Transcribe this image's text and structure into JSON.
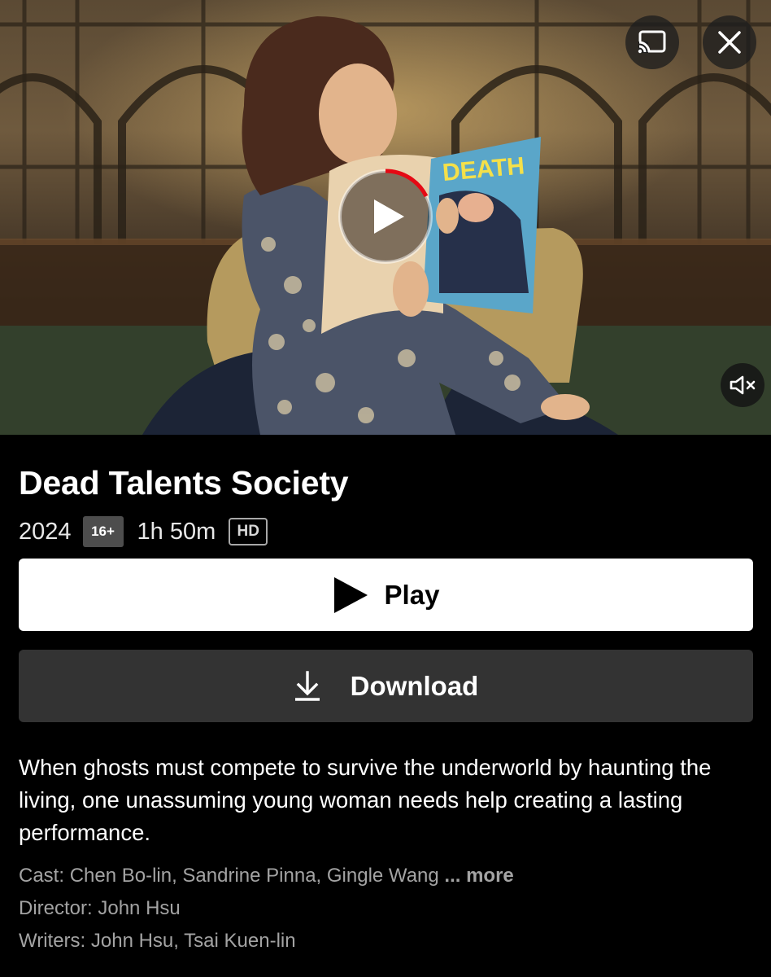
{
  "hero": {
    "cast_icon": "cast-icon",
    "close_icon": "close-icon",
    "play_icon": "play-icon",
    "mute_icon": "volume-muted-icon",
    "magazine_text": "DEATH",
    "progress_color": "#e50914"
  },
  "title": "Dead Talents Society",
  "meta": {
    "year": "2024",
    "rating": "16+",
    "duration": "1h 50m",
    "quality": "HD"
  },
  "buttons": {
    "play_label": "Play",
    "download_label": "Download"
  },
  "description": "When ghosts must compete to survive the underworld by haunting the living, one unassuming young woman needs help creating a lasting performance.",
  "credits": {
    "cast_label": "Cast:",
    "cast_names": "Chen Bo-lin, Sandrine Pinna, Gingle Wang",
    "ellipsis": "...",
    "more_label": "more",
    "director_label": "Director:",
    "director_name": "John Hsu",
    "writers_label": "Writers:",
    "writers_names": "John Hsu, Tsai Kuen-lin"
  }
}
